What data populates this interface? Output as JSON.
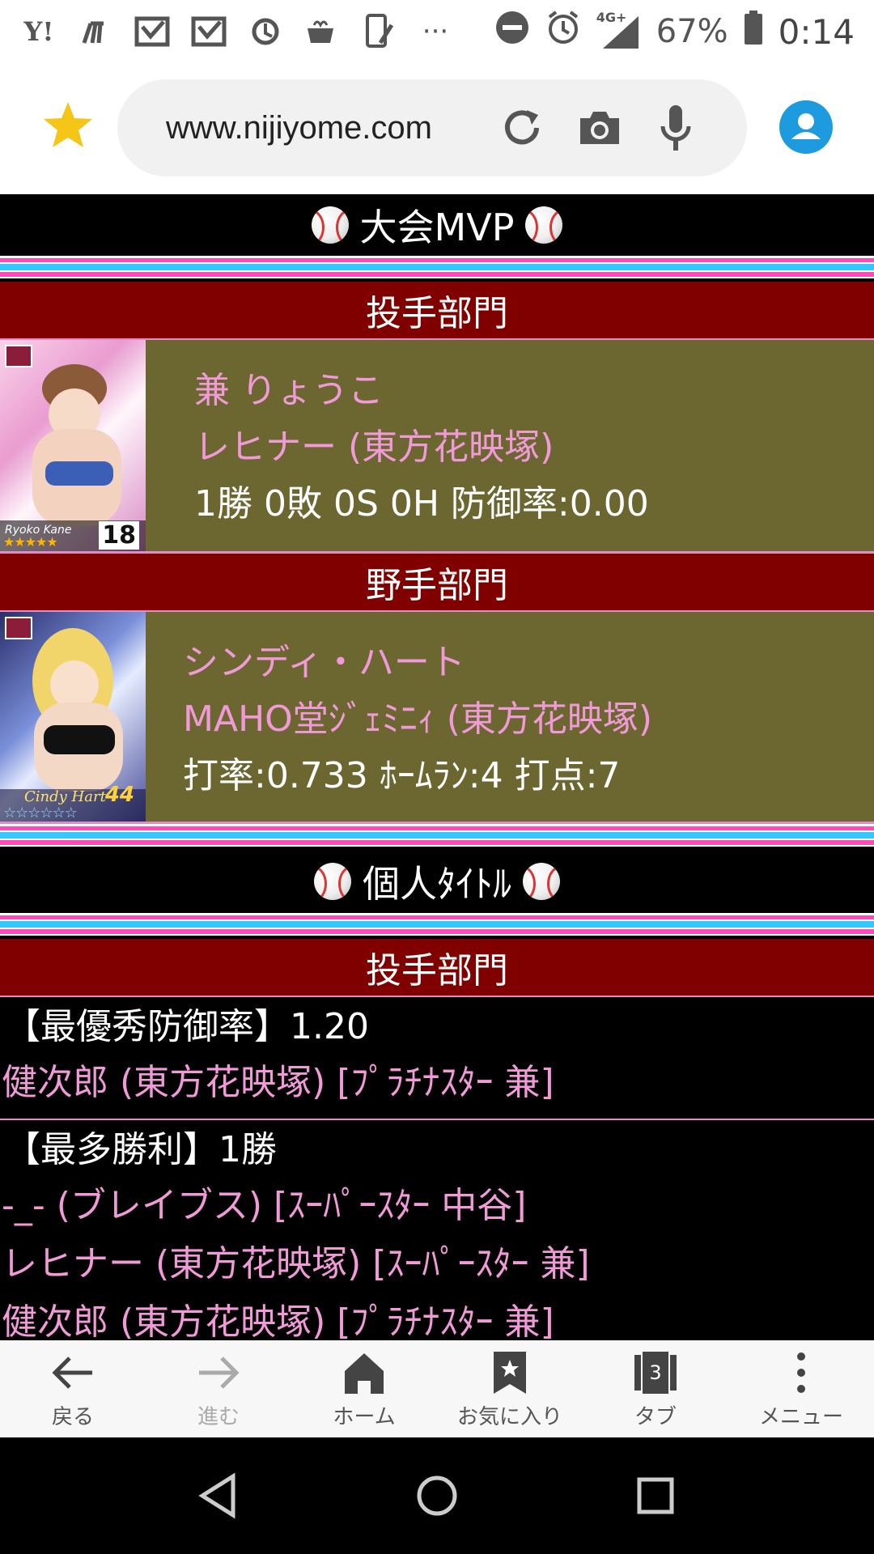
{
  "status_bar": {
    "left_icons": [
      "yahoo-icon",
      "fork-icon",
      "mail-check-icon",
      "mail-check-icon",
      "sync-icon",
      "cafe-icon",
      "phone-edit-icon",
      "more-icon"
    ],
    "yahoo_text": "Y!",
    "more_text": "···",
    "network": "4G+",
    "battery": "67%",
    "time": "0:14"
  },
  "browser": {
    "url": "www.nijiyome.com"
  },
  "mvp_section": {
    "title": "大会MVP",
    "pitcher_category": "投手部門",
    "pitcher": {
      "name": "兼 りょうこ",
      "team": "レヒナー (東方花映塚)",
      "stats": "1勝 0敗 0S 0H 防御率:0.00",
      "card_caption": "Ryoko Kane",
      "card_number": "18"
    },
    "fielder_category": "野手部門",
    "fielder": {
      "name": "シンディ・ハート",
      "team": "MAHO堂ｼﾞｪﾐﾆｨ (東方花映塚)",
      "stats": "打率:0.733 ﾎｰﾑﾗﾝ:4 打点:7",
      "card_caption": "Cindy Hart",
      "card_number": "44"
    }
  },
  "titles_section": {
    "title": "個人ﾀｲﾄﾙ",
    "pitcher_category": "投手部門",
    "entries": [
      {
        "head": "【最優秀防御率】1.20",
        "players": [
          "健次郎 (東方花映塚) [ﾌﾟﾗﾁﾅｽﾀｰ 兼]"
        ]
      },
      {
        "head": "【最多勝利】1勝",
        "players": [
          "-_- (ブレイブス) [ｽｰﾊﾟｰｽﾀｰ 中谷]",
          "レヒナー (東方花映塚) [ｽｰﾊﾟｰｽﾀｰ 兼]",
          "健次郎 (東方花映塚) [ﾌﾟﾗﾁﾅｽﾀｰ 兼]"
        ]
      }
    ]
  },
  "bottom_bar": {
    "back": "戻る",
    "forward": "進む",
    "home": "ホーム",
    "bookmarks": "お気に入り",
    "tabs": "タブ",
    "tab_count": "3",
    "menu": "メニュー"
  }
}
